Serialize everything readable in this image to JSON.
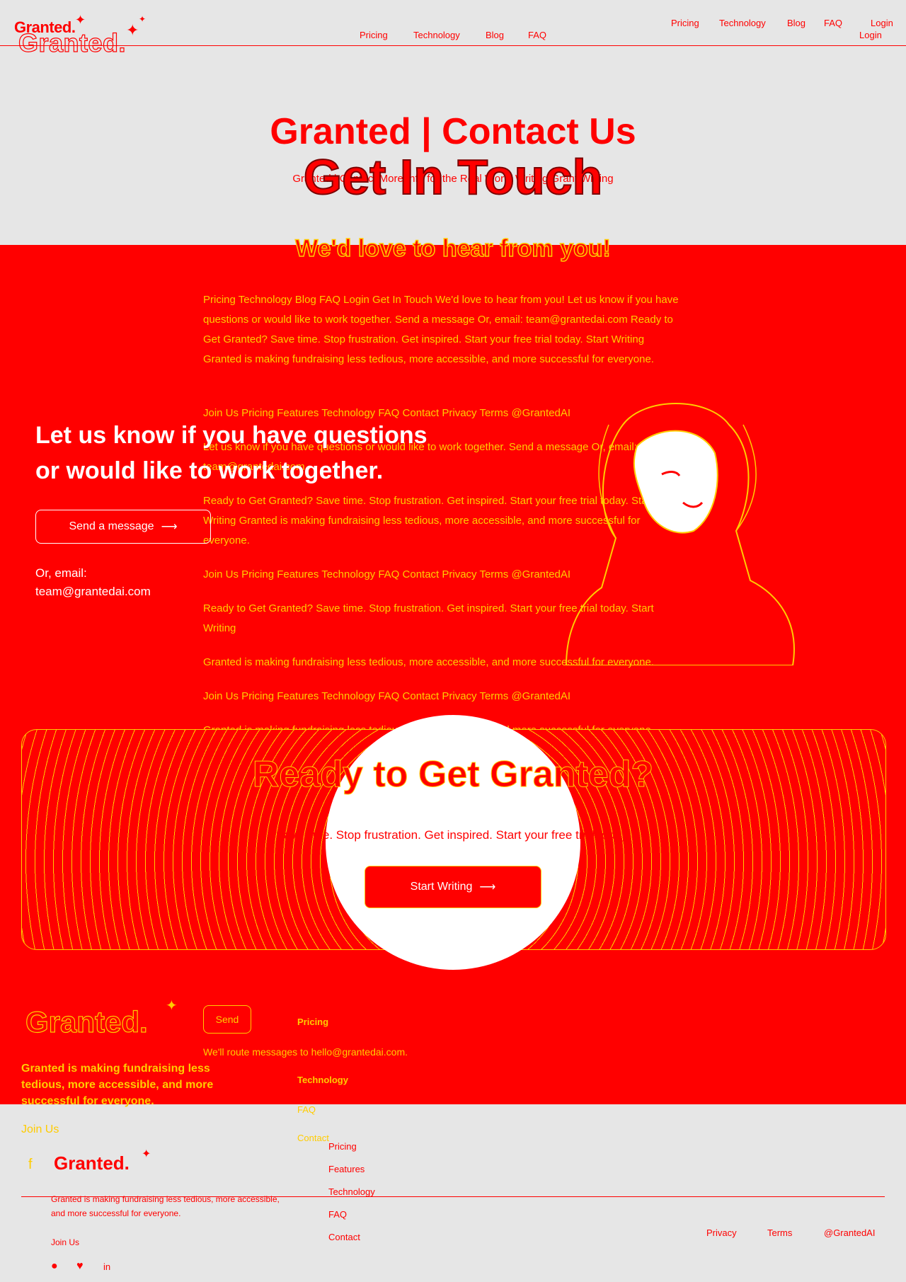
{
  "header": {
    "logo_small": "Granted.",
    "logo_big": "Granted.",
    "nav_center": [
      "Pricing",
      "Technology",
      "Blog",
      "FAQ"
    ],
    "nav_right": [
      "Pricing",
      "Technology",
      "Blog",
      "FAQ",
      "Login"
    ],
    "login": "Login"
  },
  "hero": {
    "title": "Granted | Contact Us",
    "subtitle": "Granted | Contact More Info for the Real World Writing Grant Writing",
    "heading": "Get In Touch",
    "tagline": "We'd love to hear from you!"
  },
  "content": {
    "para1": "Pricing Technology Blog FAQ Login Get In Touch We'd love to hear from you! Let us know if you have questions or would like to work together. Send a message Or, email: team@grantedai.com Ready to Get Granted? Save time. Stop frustration. Get inspired. Start your free trial today. Start Writing Granted is making fundraising less tedious, more accessible, and more successful for everyone.",
    "para2": "Join Us Pricing Features Technology FAQ Contact Privacy Terms @GrantedAI",
    "para3": "Let us know if you have questions or would like to work together. Send a message Or, email: team@grantedai.com",
    "para4": "Ready to Get Granted? Save time. Stop frustration. Get inspired. Start your free trial today. Start Writing Granted is making fundraising less tedious, more accessible, and more successful for everyone.",
    "para5": "Join Us Pricing Features Technology FAQ Contact Privacy Terms @GrantedAI",
    "para6": "Ready to Get Granted? Save time. Stop frustration. Get inspired. Start your free trial today. Start Writing",
    "para7": "Granted is making fundraising less tedious, more accessible, and more successful for everyone.",
    "para8": "Join Us Pricing Features Technology FAQ Contact Privacy Terms @GrantedAI",
    "para9": "Granted is making fundraising less tedious, more accessible, and more successful for everyone."
  },
  "contact": {
    "heading_line1": "Let us know if you have questions",
    "heading_line2": "or would like to work together.",
    "send_button": "Send a message",
    "email_label": "Or, email:",
    "email": "team@grantedai.com"
  },
  "cta": {
    "title": "Ready to Get Granted?",
    "subtitle": "Save time. Stop frustration. Get inspired. Start your free trial today.",
    "button": "Start Writing"
  },
  "form": {
    "send": "Send",
    "note": "We'll route messages to hello@grantedai.com."
  },
  "footer": {
    "logo": "Granted.",
    "tagline": "Granted is making fundraising less tedious, more accessible, and more successful for everyone.",
    "join": "Join Us",
    "col1": [
      "Pricing",
      "Technology",
      "FAQ",
      "Contact"
    ]
  },
  "bottom": {
    "logo": "Granted.",
    "tagline": "Granted is making fundraising less tedious, more accessible, and more successful for everyone.",
    "join": "Join Us",
    "links": [
      "Pricing",
      "Features",
      "Technology",
      "FAQ",
      "Contact"
    ],
    "legal": [
      "Privacy",
      "Terms",
      "@GrantedAI"
    ]
  },
  "colors": {
    "accent": "#ff0000",
    "secondary": "#ffcc00",
    "background": "#e6e6e6"
  }
}
